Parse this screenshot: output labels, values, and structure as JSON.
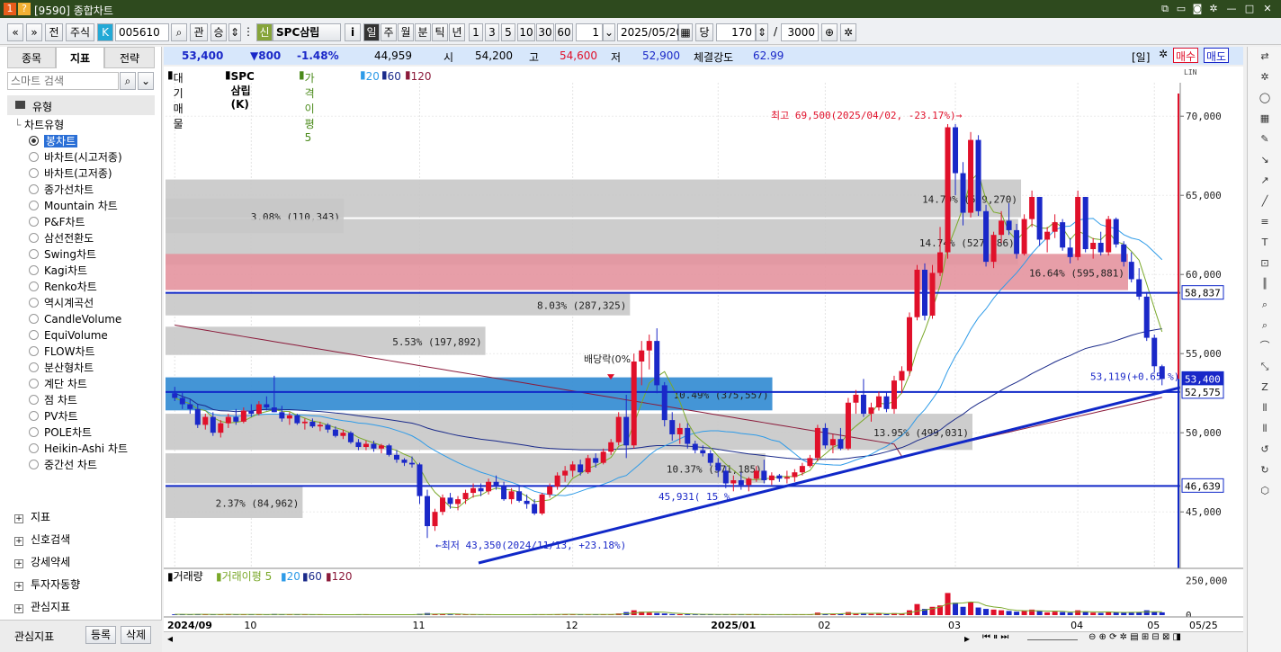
{
  "window": {
    "icon1": "1",
    "icon2": "?",
    "title": "[9590] 종합차트"
  },
  "toolbar": {
    "prev": "«",
    "next": "»",
    "btn_jeon": "전",
    "market": "주식",
    "k_badge": "K",
    "code": "005610",
    "btn_gwan": "관",
    "btn_seung": "승",
    "shin_badge": "신",
    "stock_name": "SPC삼립",
    "info": "i",
    "periods": [
      "일",
      "주",
      "월",
      "분",
      "틱",
      "년"
    ],
    "minutes": [
      "1",
      "3",
      "5",
      "10",
      "30",
      "60"
    ],
    "interval": "1",
    "date": "2025/05/20",
    "dang": "당",
    "count": "170",
    "slash": "/",
    "total": "3000"
  },
  "left": {
    "tabs": [
      "종목",
      "지표",
      "전략"
    ],
    "search_placeholder": "스마트 검색",
    "section_type": "유형",
    "tree_label": "차트유형",
    "chart_types": [
      "봉차트",
      "바차트(시고저종)",
      "바차트(고저종)",
      "종가선차트",
      "Mountain 차트",
      "P&F차트",
      "삼선전환도",
      "Swing차트",
      "Kagi차트",
      "Renko차트",
      "역시계곡선",
      "CandleVolume",
      "EquiVolume",
      "FLOW차트",
      "분산형차트",
      "계단 차트",
      "점 차트",
      "PV차트",
      "POLE차트",
      "Heikin-Ashi 차트",
      "중간선 차트"
    ],
    "selected_index": 0,
    "sections": [
      "지표",
      "신호검색",
      "강세약세",
      "투자자동향",
      "관심지표"
    ],
    "footer_label": "관심지표",
    "footer_btn1": "등록",
    "footer_btn2": "삭제"
  },
  "infobar": {
    "price": "53,400",
    "change": "▼800",
    "pct": "-1.48%",
    "volume": "44,959",
    "open_label": "시",
    "open": "54,200",
    "high_label": "고",
    "high": "54,600",
    "low_label": "저",
    "low": "52,900",
    "strength_label": "체결강도",
    "strength": "62.99",
    "period_btn": "[일]",
    "buy": "매수",
    "sell": "매도"
  },
  "legend": {
    "items": [
      "대기매물",
      "SPC삼립(K)",
      "가격이평 5",
      "20",
      "60",
      "120"
    ]
  },
  "volume_legend": {
    "items": [
      "거래량",
      "거래이평 5",
      "20",
      "60",
      "120"
    ]
  },
  "colors": {
    "up": "#e0102a",
    "down": "#1a28c8",
    "ma5": "#7aa82a",
    "ma20": "#2e9be8",
    "ma60": "#1a2a8a",
    "ma120": "#8b1a3a",
    "line": "#1028c8"
  },
  "chart_data": {
    "type": "candlestick",
    "y_ticks": [
      "70,000",
      "65,000",
      "60,000",
      "55,000",
      "50,000",
      "45,000"
    ],
    "x_ticks": [
      "2024/09",
      "10",
      "11",
      "12",
      "2025/01",
      "02",
      "03",
      "04",
      "05"
    ],
    "volume_ticks": [
      "250,000",
      "0"
    ],
    "price_labels": {
      "current": "53,400",
      "p1": "58,837",
      "p2": "52,575",
      "p3": "46,639"
    },
    "annotations": {
      "high": "최고 69,500(2025/04/02, -23.17%)",
      "low": "←최저 43,350(2024/11/13, +23.18%)",
      "dividend": "배당락(0%",
      "low2": "45,931( 15 %",
      "last": "53,119(+0.65 %)",
      "lastdate": "05/25"
    },
    "supply_zones": [
      {
        "label": "14.79% (529,270)"
      },
      {
        "label": "3.08% (110,343)"
      },
      {
        "label": "14.74% (527,486)"
      },
      {
        "label": "16.64% (595,881)"
      },
      {
        "label": "8.03% (287,325)"
      },
      {
        "label": "5.53% (197,892)"
      },
      {
        "label": "10.49% (375,557)"
      },
      {
        "label": "13.95% (499,031)"
      },
      {
        "label": "10.37% (371,185)"
      },
      {
        "label": "2.37% (84,962)"
      }
    ],
    "ohlc": [
      [
        52500,
        52900,
        52000,
        52200
      ],
      [
        52200,
        52600,
        51500,
        51800
      ],
      [
        51800,
        52100,
        51200,
        51500
      ],
      [
        51500,
        51800,
        50300,
        50500
      ],
      [
        50500,
        51200,
        50200,
        51000
      ],
      [
        51000,
        51300,
        49800,
        50000
      ],
      [
        50000,
        50800,
        49700,
        50600
      ],
      [
        50600,
        51200,
        50300,
        51000
      ],
      [
        51000,
        51500,
        50500,
        50700
      ],
      [
        50700,
        51600,
        50600,
        51400
      ],
      [
        51400,
        51800,
        51000,
        51200
      ],
      [
        51200,
        52000,
        51100,
        51800
      ],
      [
        51800,
        52300,
        51400,
        51600
      ],
      [
        51600,
        53600,
        51300,
        51300
      ],
      [
        51300,
        51700,
        50700,
        50900
      ],
      [
        50900,
        51300,
        50500,
        51100
      ],
      [
        51100,
        51200,
        50500,
        50600
      ],
      [
        50600,
        50900,
        50200,
        50700
      ],
      [
        50700,
        50900,
        50300,
        50400
      ],
      [
        50400,
        50700,
        50100,
        50500
      ],
      [
        50500,
        50600,
        50000,
        50200
      ],
      [
        50200,
        50400,
        49700,
        49800
      ],
      [
        49800,
        50200,
        49600,
        50000
      ],
      [
        50000,
        50100,
        49300,
        49400
      ],
      [
        49400,
        49600,
        48900,
        49100
      ],
      [
        49100,
        49500,
        48900,
        49300
      ],
      [
        49300,
        49500,
        48800,
        49000
      ],
      [
        49000,
        49300,
        48700,
        49200
      ],
      [
        49200,
        49300,
        48500,
        48600
      ],
      [
        48600,
        48900,
        48100,
        48300
      ],
      [
        48300,
        48400,
        47900,
        48100
      ],
      [
        48100,
        48500,
        47800,
        48000
      ],
      [
        48000,
        48100,
        45500,
        46000
      ],
      [
        46000,
        46400,
        43350,
        44100
      ],
      [
        44100,
        45200,
        43800,
        45000
      ],
      [
        45000,
        46100,
        44800,
        45900
      ],
      [
        45900,
        46200,
        45200,
        45500
      ],
      [
        45500,
        46000,
        45100,
        45800
      ],
      [
        45800,
        46400,
        45500,
        46200
      ],
      [
        46200,
        46800,
        45900,
        46500
      ],
      [
        46500,
        46800,
        46000,
        46300
      ],
      [
        46300,
        47100,
        46100,
        46900
      ],
      [
        46900,
        47300,
        46400,
        46600
      ],
      [
        46600,
        46900,
        45700,
        45800
      ],
      [
        45800,
        46500,
        45500,
        46300
      ],
      [
        46300,
        46600,
        45600,
        45700
      ],
      [
        45700,
        46100,
        45200,
        45500
      ],
      [
        45500,
        45800,
        44800,
        44900
      ],
      [
        44900,
        46200,
        44800,
        46100
      ],
      [
        46100,
        46800,
        45900,
        46600
      ],
      [
        46600,
        47500,
        46400,
        47300
      ],
      [
        47300,
        47900,
        46900,
        47600
      ],
      [
        47600,
        48200,
        47200,
        48000
      ],
      [
        48000,
        48300,
        47300,
        47500
      ],
      [
        47500,
        48600,
        47400,
        48400
      ],
      [
        48400,
        48700,
        47800,
        48100
      ],
      [
        48100,
        49000,
        48000,
        48800
      ],
      [
        48800,
        49600,
        48600,
        49400
      ],
      [
        49400,
        51300,
        49200,
        51000
      ],
      [
        51000,
        52400,
        48400,
        49200
      ],
      [
        49200,
        55000,
        49000,
        54500
      ],
      [
        54500,
        55800,
        53000,
        55200
      ],
      [
        55200,
        56200,
        54000,
        55800
      ],
      [
        55800,
        56600,
        52500,
        53000
      ],
      [
        53000,
        53200,
        50400,
        50800
      ],
      [
        50800,
        51300,
        49500,
        49900
      ],
      [
        49900,
        50600,
        49300,
        50300
      ],
      [
        50300,
        50600,
        49000,
        49300
      ],
      [
        49300,
        49500,
        48700,
        48900
      ],
      [
        48900,
        49200,
        48500,
        48700
      ],
      [
        48700,
        48900,
        47900,
        48100
      ],
      [
        48100,
        48400,
        47200,
        47600
      ],
      [
        47600,
        47900,
        46500,
        46800
      ],
      [
        46800,
        47300,
        46300,
        47000
      ],
      [
        47000,
        47500,
        46400,
        46700
      ],
      [
        46700,
        47200,
        46300,
        47100
      ],
      [
        47100,
        47900,
        46900,
        47600
      ],
      [
        47600,
        48300,
        46800,
        47000
      ],
      [
        47000,
        47500,
        46700,
        47300
      ],
      [
        47300,
        47400,
        46900,
        47100
      ],
      [
        47100,
        47600,
        46800,
        47200
      ],
      [
        47200,
        47700,
        46900,
        47500
      ],
      [
        47500,
        48100,
        47300,
        47900
      ],
      [
        47900,
        48600,
        47800,
        48400
      ],
      [
        48400,
        50500,
        48200,
        50300
      ],
      [
        50300,
        50600,
        49000,
        49200
      ],
      [
        49200,
        49900,
        48700,
        49600
      ],
      [
        49600,
        50300,
        48900,
        49000
      ],
      [
        49000,
        52200,
        48900,
        51900
      ],
      [
        51900,
        52700,
        51200,
        52400
      ],
      [
        52400,
        53400,
        51000,
        51200
      ],
      [
        51200,
        51900,
        50700,
        51600
      ],
      [
        51600,
        52600,
        51400,
        52300
      ],
      [
        52300,
        52600,
        51300,
        51500
      ],
      [
        51500,
        53600,
        51200,
        53300
      ],
      [
        53300,
        54200,
        52500,
        53900
      ],
      [
        53900,
        57600,
        53600,
        57300
      ],
      [
        57300,
        60600,
        57100,
        60300
      ],
      [
        60300,
        60700,
        57100,
        57400
      ],
      [
        57400,
        60600,
        57200,
        60100
      ],
      [
        60100,
        63000,
        59900,
        61400
      ],
      [
        61400,
        69500,
        61000,
        69300
      ],
      [
        69300,
        69500,
        65000,
        66400
      ],
      [
        66400,
        67100,
        63100,
        63900
      ],
      [
        63900,
        69000,
        63600,
        68500
      ],
      [
        68500,
        68800,
        63700,
        64000
      ],
      [
        64000,
        64400,
        60500,
        60800
      ],
      [
        60800,
        62700,
        60400,
        62500
      ],
      [
        62500,
        64000,
        62000,
        63400
      ],
      [
        63400,
        64500,
        62500,
        62800
      ],
      [
        62800,
        63200,
        61000,
        61300
      ],
      [
        61300,
        63800,
        61200,
        63500
      ],
      [
        63500,
        65300,
        63000,
        64900
      ],
      [
        64900,
        64900,
        61800,
        62200
      ],
      [
        62200,
        63000,
        61400,
        62700
      ],
      [
        62700,
        63800,
        62300,
        63300
      ],
      [
        63300,
        63500,
        61500,
        61700
      ],
      [
        61700,
        62300,
        60700,
        61100
      ],
      [
        61100,
        65300,
        60900,
        64900
      ],
      [
        64900,
        64900,
        61400,
        61600
      ],
      [
        61600,
        62300,
        61000,
        62000
      ],
      [
        62000,
        62700,
        61200,
        61400
      ],
      [
        61400,
        63700,
        61200,
        63500
      ],
      [
        63500,
        63600,
        61700,
        61900
      ],
      [
        61900,
        62100,
        60500,
        60800
      ],
      [
        60800,
        61400,
        59500,
        59700
      ],
      [
        59700,
        60400,
        58400,
        58600
      ],
      [
        58600,
        58900,
        55800,
        56000
      ],
      [
        56000,
        56200,
        53800,
        54200
      ],
      [
        54200,
        54300,
        53000,
        53400
      ]
    ],
    "volumes": [
      6000,
      5000,
      4000,
      7000,
      5000,
      5000,
      4000,
      6000,
      4000,
      5000,
      4000,
      5000,
      4000,
      8000,
      5000,
      4000,
      4000,
      4000,
      3000,
      4000,
      3000,
      4000,
      3000,
      4000,
      5000,
      3000,
      3000,
      3000,
      4000,
      5000,
      3000,
      3000,
      9000,
      15000,
      8000,
      7000,
      5000,
      4000,
      4000,
      4000,
      3000,
      4000,
      3000,
      4000,
      4000,
      3000,
      3000,
      5000,
      6000,
      5000,
      6000,
      5000,
      5000,
      4000,
      5000,
      4000,
      5000,
      6000,
      12000,
      22000,
      35000,
      25000,
      18000,
      15000,
      12000,
      8000,
      7000,
      6000,
      5000,
      4000,
      5000,
      5000,
      6000,
      4000,
      4000,
      4000,
      5000,
      5000,
      4000,
      3000,
      4000,
      4000,
      5000,
      6000,
      18000,
      9000,
      7000,
      8000,
      22000,
      12000,
      15000,
      9000,
      10000,
      8000,
      14000,
      13000,
      35000,
      80000,
      45000,
      60000,
      70000,
      160000,
      90000,
      60000,
      95000,
      55000,
      45000,
      40000,
      35000,
      30000,
      25000,
      30000,
      40000,
      30000,
      20000,
      25000,
      22000,
      18000,
      35000,
      25000,
      18000,
      16000,
      25000,
      22000,
      18000,
      20000,
      22000,
      35000,
      25000,
      20000
    ]
  }
}
